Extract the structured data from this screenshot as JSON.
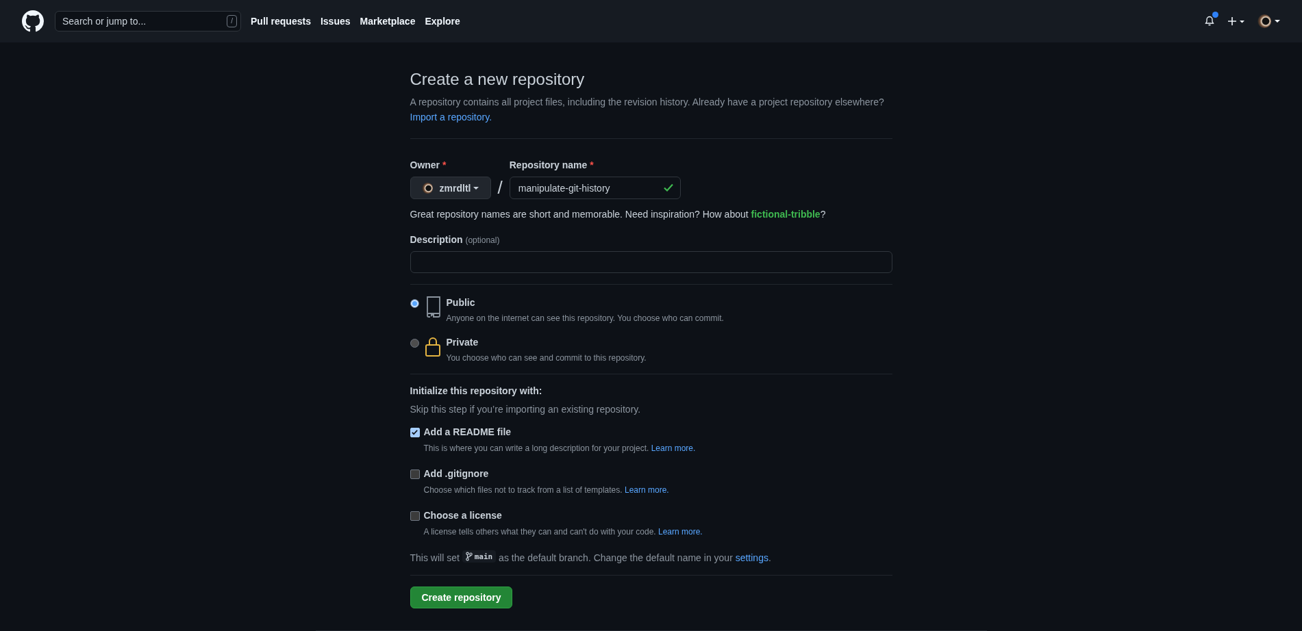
{
  "header": {
    "search": {
      "placeholder": "Search or jump to..."
    },
    "shortcut_key": "/",
    "nav": [
      "Pull requests",
      "Issues",
      "Marketplace",
      "Explore"
    ],
    "notifications_unread": true
  },
  "page": {
    "title": "Create a new repository",
    "intro": "A repository contains all project files, including the revision history. Already have a project repository elsewhere?",
    "import_link": "Import a repository."
  },
  "owner": {
    "label": "Owner",
    "required_mark": "*",
    "value": "zmrdltl"
  },
  "separator": "/",
  "repo_name": {
    "label": "Repository name",
    "required_mark": "*",
    "value": "manipulate-git-history",
    "valid": true
  },
  "name_hint": {
    "text": "Great repository names are short and memorable. Need inspiration? How about",
    "suggestion": "fictional-tribble",
    "after": "?"
  },
  "description": {
    "label": "Description",
    "optional": "(optional)"
  },
  "visibility": [
    {
      "kind": "public",
      "title": "Public",
      "text": "Anyone on the internet can see this repository. You choose who can commit.",
      "selected": true
    },
    {
      "kind": "private",
      "title": "Private",
      "text": "You choose who can see and commit to this repository.",
      "selected": false
    }
  ],
  "initialize": {
    "title": "Initialize this repository with:",
    "subtitle": "Skip this step if you’re importing an existing repository.",
    "options": [
      {
        "label": "Add a README file",
        "text": "This is where you can write a long description for your project.",
        "link": "Learn more.",
        "checked": true
      },
      {
        "label": "Add .gitignore",
        "text": "Choose which files not to track from a list of templates.",
        "link": "Learn more.",
        "checked": false
      },
      {
        "label": "Choose a license",
        "text": "A license tells others what they can and can't do with your code.",
        "link": "Learn more.",
        "checked": false
      }
    ]
  },
  "default_branch": {
    "before": "This will set",
    "branch": "main",
    "middle": "as the default branch. Change the default name in your",
    "link": "settings",
    "after": "."
  },
  "submit": "Create repository"
}
